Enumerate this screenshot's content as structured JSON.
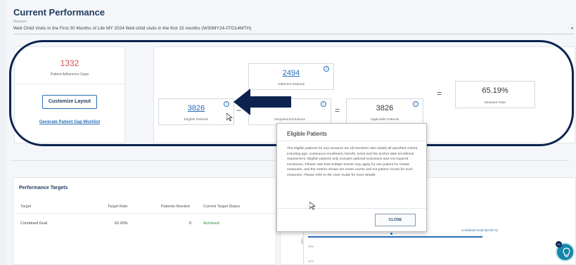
{
  "header": {
    "title": "Current Performance",
    "measure_label": "Measure",
    "measure_value": "Well Child Visits in the First 30 Months of Life MY 2024 Well child visits in the first 15 months (W30MY24-0TO14MTH)",
    "caret": "▾"
  },
  "left_card": {
    "gap_count": "1332",
    "gap_label": "Patient Adherence Gaps",
    "customize_button": "Customize Layout",
    "generate_link": "Generate Patient Gap Worklist"
  },
  "metrics": {
    "adherent": {
      "value": "2494",
      "label": "Adherent Patients"
    },
    "eligible": {
      "value": "3826",
      "label": "Eligible Patients"
    },
    "required_exclusions": {
      "value": "",
      "label": "Required Exclusions"
    },
    "applicable": {
      "value": "3826",
      "label": "Applicable Patients"
    },
    "rate": {
      "value": "65.19%",
      "label": "Measure Rate"
    },
    "info_glyph": "i",
    "op_minus": "−",
    "op_equals": "="
  },
  "tooltip": {
    "title": "Eligible Patients",
    "body": "The eligible patients for any measure are all members who satisfy all specified criteria, including age, continuous enrollment, benefit, event and the anchor date enrollment requirement. Eligible patients only includes optional exclusions and not required exclusions. Please note that multiple events may apply for one patient for certain measures, and the metrics shown are event counts and not patient counts for such measures. Please refer to the User Guide for more details.",
    "close_button": "CLOSE"
  },
  "targets": {
    "title": "Performance Targets",
    "columns": [
      "Target",
      "Target Rate",
      "Patients Needed",
      "Current Target Status"
    ],
    "rows": [
      {
        "target": "Combined Goal",
        "rate": "62.00%",
        "needed": "0",
        "status": "Achieved"
      }
    ]
  },
  "chart": {
    "legend": "Combined Goal (62.00 %)",
    "y_ticks": [
      "30%",
      "25%"
    ],
    "ylabel": "Rate"
  },
  "help": {
    "badge": "15"
  },
  "colors": {
    "brand_navy": "#0c2350",
    "link_blue": "#2a6db5",
    "gap_red": "#d9534f",
    "achieved_green": "#2e8b3a",
    "help_teal": "#1686a6"
  }
}
